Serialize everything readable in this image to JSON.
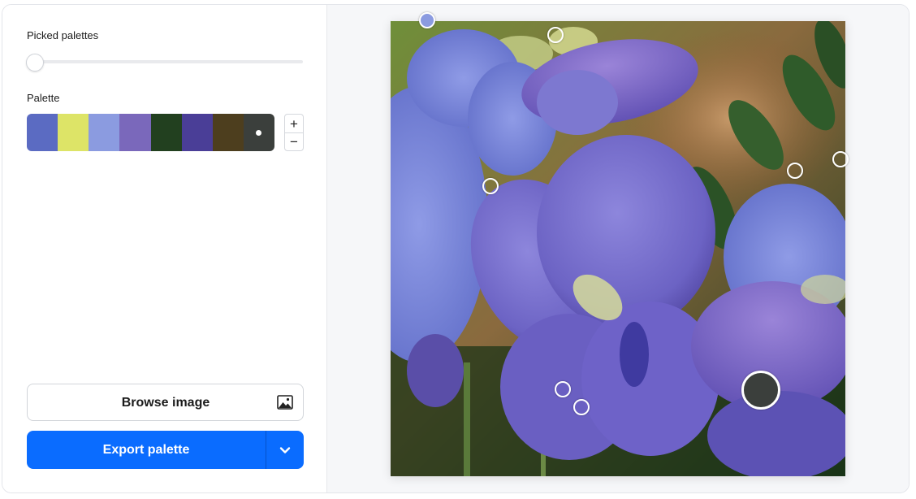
{
  "sidebar": {
    "picked_label": "Picked palettes",
    "palette_label": "Palette",
    "stepper": {
      "plus": "+",
      "minus": "−"
    },
    "browse_label": "Browse image",
    "export_label": "Export palette",
    "slider_value": 0
  },
  "palette": [
    {
      "color": "#5b6bc2"
    },
    {
      "color": "#dde467"
    },
    {
      "color": "#8b9be0"
    },
    {
      "color": "#7a68bb"
    },
    {
      "color": "#22401f"
    },
    {
      "color": "#4a3e97"
    },
    {
      "color": "#4d3e1e"
    },
    {
      "color": "#3b3f3c",
      "selected": true
    }
  ],
  "colors": {
    "accent": "#0a6cff",
    "canvas_bg": "#f6f7f9"
  },
  "image": {
    "subject": "purple-flowers-photo"
  }
}
